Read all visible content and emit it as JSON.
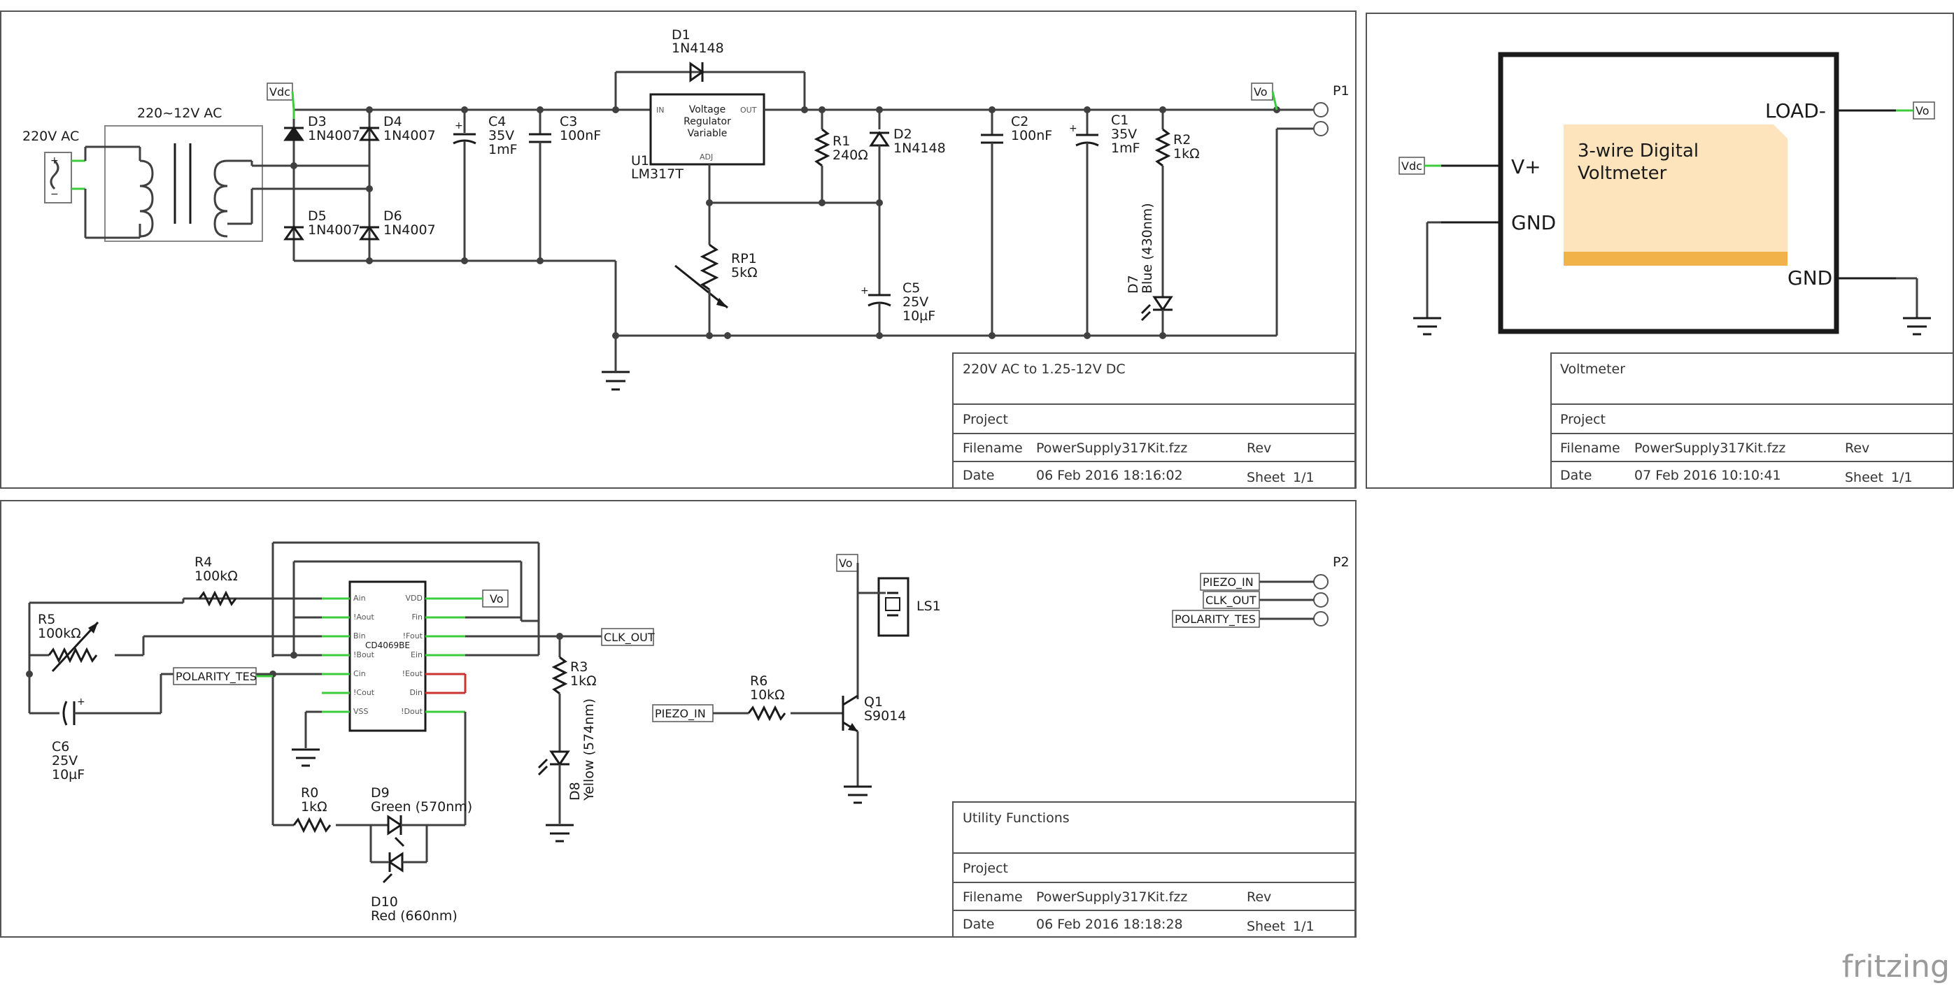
{
  "sheets": {
    "power": {
      "title_block": {
        "title": "220V AC to 1.25-12V DC",
        "project_label": "Project",
        "filename_label": "Filename",
        "filename": "PowerSupply317Kit.fzz",
        "rev_label": "Rev",
        "date_label": "Date",
        "date": "06 Feb 2016 18:16:02",
        "sheet_label": "Sheet",
        "sheet": "1/1"
      },
      "labels": {
        "ac_in": "220V AC",
        "transformer": "220~12V AC",
        "d3": "D3",
        "d3v": "1N4007",
        "d4": "D4",
        "d4v": "1N4007",
        "d5": "D5",
        "d5v": "1N4007",
        "d6": "D6",
        "d6v": "1N4007",
        "c4": "C4",
        "c4v1": "35V",
        "c4v2": "1mF",
        "c3": "C3",
        "c3v": "100nF",
        "d1": "D1",
        "d1v": "1N4148",
        "u1": "U1",
        "u1v": "LM317T",
        "u1_t1": "Voltage",
        "u1_t2": "Regulator",
        "u1_t3": "Variable",
        "u1_in": "IN",
        "u1_out": "OUT",
        "u1_adj": "ADJ",
        "r1": "R1",
        "r1v": "240Ω",
        "d2": "D2",
        "d2v": "1N4148",
        "rp1": "RP1",
        "rp1v": "5kΩ",
        "c5": "C5",
        "c5v1": "25V",
        "c5v2": "10µF",
        "c2": "C2",
        "c2v": "100nF",
        "c1": "C1",
        "c1v1": "35V",
        "c1v2": "1mF",
        "r2": "R2",
        "r2v": "1kΩ",
        "d7": "D7",
        "d7v": "Blue (430nm)",
        "p1": "P1",
        "vdc": "Vdc",
        "vo": "Vo"
      }
    },
    "voltmeter": {
      "title_block": {
        "title": "Voltmeter",
        "project_label": "Project",
        "filename_label": "Filename",
        "filename": "PowerSupply317Kit.fzz",
        "rev_label": "Rev",
        "date_label": "Date",
        "date": "07 Feb 2016 10:10:41",
        "sheet_label": "Sheet",
        "sheet": "1/1"
      },
      "labels": {
        "note_line1": "3-wire Digital",
        "note_line2": "Voltmeter",
        "vplus": "V+",
        "gnd_left": "GND",
        "load_minus": "LOAD-",
        "gnd_right": "GND",
        "vdc": "Vdc",
        "vo": "Vo"
      }
    },
    "utility": {
      "title_block": {
        "title": "Utility Functions",
        "project_label": "Project",
        "filename_label": "Filename",
        "filename": "PowerSupply317Kit.fzz",
        "rev_label": "Rev",
        "date_label": "Date",
        "date": "06 Feb 2016 18:18:28",
        "sheet_label": "Sheet",
        "sheet": "1/1"
      },
      "labels": {
        "r4": "R4",
        "r4v": "100kΩ",
        "r5": "R5",
        "r5v": "100kΩ",
        "c6": "C6",
        "c6v1": "25V",
        "c6v2": "10µF",
        "polarity": "POLARITY_TES",
        "ic": "CD4069BE",
        "pins_l": [
          "Ain",
          "!Aout",
          "Bin",
          "!Bout",
          "Cin",
          "!Cout",
          "VSS"
        ],
        "pins_r": [
          "VDD",
          "Fin",
          "!Fout",
          "Ein",
          "!Eout",
          "Din",
          "!Dout"
        ],
        "vo": "Vo",
        "clk_out": "CLK_OUT",
        "r3": "R3",
        "r3v": "1kΩ",
        "d8": "D8",
        "d8v": "Yellow (574nm)",
        "r0": "R0",
        "r0v": "1kΩ",
        "d9": "D9",
        "d9v": "Green (570nm)",
        "d10": "D10",
        "d10v": "Red (660nm)",
        "ls1": "LS1",
        "r6": "R6",
        "r6v": "10kΩ",
        "q1": "Q1",
        "q1v": "S9014",
        "piezo_in": "PIEZO_IN",
        "p2": "P2",
        "p2_nets": [
          "PIEZO_IN",
          "CLK_OUT",
          "POLARITY_TES"
        ]
      }
    }
  },
  "branding": {
    "logo": "fritzing"
  }
}
